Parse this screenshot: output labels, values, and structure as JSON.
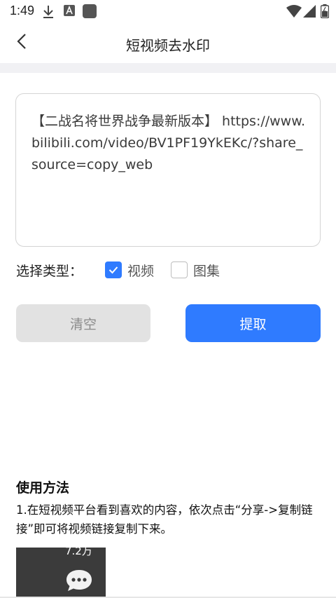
{
  "status_bar": {
    "time": "1:49",
    "icons": [
      "download-icon",
      "a-icon",
      "square-icon",
      "wifi-icon",
      "signal-icon",
      "battery-icon"
    ]
  },
  "header": {
    "back_icon": "chevron-left-icon",
    "title": "短视频去水印"
  },
  "input": {
    "value": "【二战名将世界战争最新版本】 https://www.bilibili.com/video/BV1PF19YkEKc/?share_source=copy_web"
  },
  "type_selector": {
    "label": "选择类型：",
    "options": [
      {
        "label": "视频",
        "checked": true
      },
      {
        "label": "图集",
        "checked": false
      }
    ]
  },
  "buttons": {
    "clear": "清空",
    "extract": "提取"
  },
  "usage": {
    "title": "使用方法",
    "step1": "1.在短视频平台看到喜欢的内容，依次点击“分享->复制链接”即可将视频链接复制下来。",
    "preview_count": "7.2万"
  },
  "colors": {
    "accent": "#2f7bff",
    "clear_button": "#e2e2e2",
    "divider": "#f1f1f4"
  }
}
